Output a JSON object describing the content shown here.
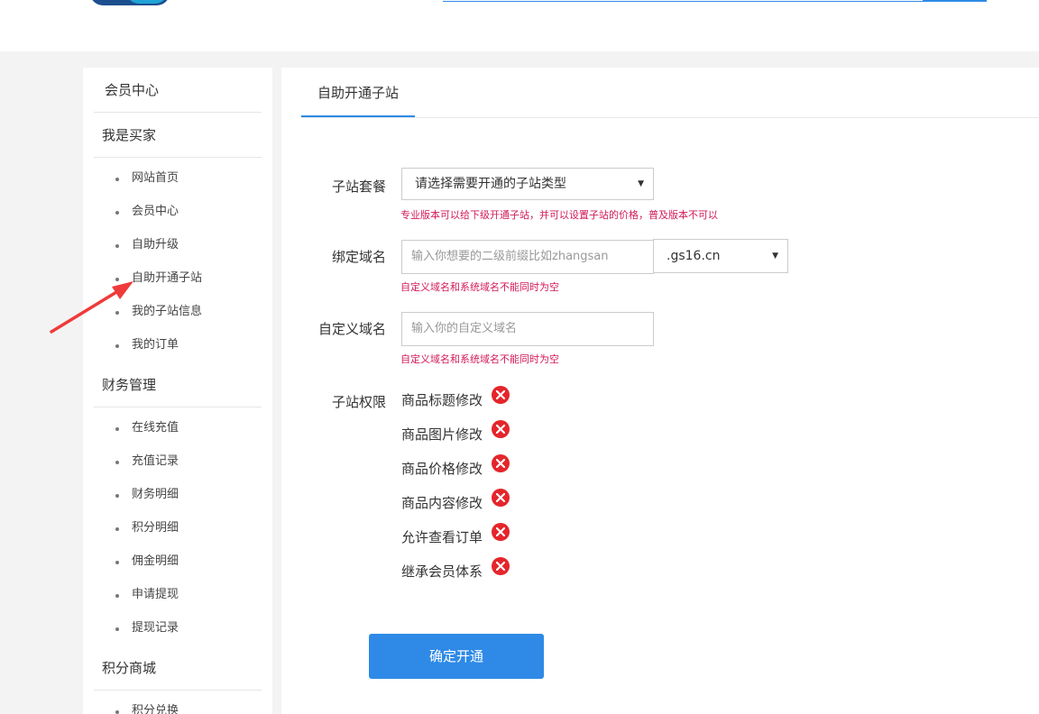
{
  "header": {
    "logo_text": "·········"
  },
  "sidebar": {
    "title": "会员中心",
    "groups": [
      {
        "label": "我是买家",
        "items": [
          "网站首页",
          "会员中心",
          "自助升级",
          "自助开通子站",
          "我的子站信息",
          "我的订单"
        ]
      },
      {
        "label": "财务管理",
        "items": [
          "在线充值",
          "充值记录",
          "财务明细",
          "积分明细",
          "佣金明细",
          "申请提现",
          "提现记录"
        ]
      },
      {
        "label": "积分商城",
        "items": [
          "积分兑换"
        ]
      }
    ]
  },
  "main": {
    "tab_label": "自助开通子站",
    "package": {
      "label": "子站套餐",
      "selected": "请选择需要开通的子站类型",
      "hint": "专业版本可以给下级开通子站，并可以设置子站的价格，普及版本不可以"
    },
    "domain": {
      "label": "绑定域名",
      "placeholder": "输入你想要的二级前缀比如zhangsan",
      "suffix": ".gs16.cn",
      "hint": "自定义域名和系统域名不能同时为空"
    },
    "custom_domain": {
      "label": "自定义域名",
      "placeholder": "输入你的自定义域名",
      "hint": "自定义域名和系统域名不能同时为空"
    },
    "permissions": {
      "label": "子站权限",
      "items": [
        "商品标题修改",
        "商品图片修改",
        "商品价格修改",
        "商品内容修改",
        "允许查看订单",
        "继承会员体系"
      ]
    },
    "submit_label": "确定开通"
  },
  "colors": {
    "accent": "#2e8ae6",
    "hint": "#d2195a",
    "error_icon": "#e4262b",
    "arrow": "#ef3b3b"
  },
  "icons": [
    "close-circle-icon",
    "caret-down-icon",
    "arrow-annotation"
  ]
}
